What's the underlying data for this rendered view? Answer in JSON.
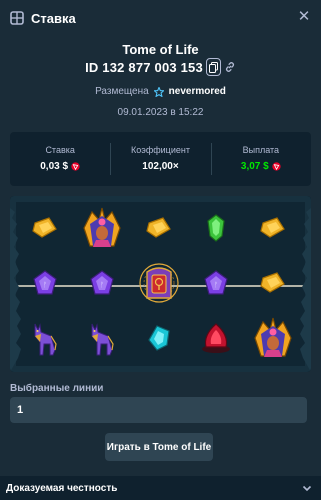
{
  "header": {
    "title": "Ставка"
  },
  "bet": {
    "game_name": "Tome of Life",
    "id": "ID 132 877 003 153",
    "placed_label": "Размещена",
    "user": "nevermored",
    "date": "09.01.2023 в 15:22"
  },
  "stats": {
    "bet_label": "Ставка",
    "bet_value": "0,03 $",
    "multiplier_label": "Коэффициент",
    "multiplier_value": "102,00×",
    "payout_label": "Выплата",
    "payout_value": "3,07 $"
  },
  "board": {
    "rows": [
      [
        "gold-gem-icon",
        "pharaoh-icon",
        "gold-gem-icon",
        "green-gem-icon",
        "gold-gem-icon"
      ],
      [
        "purple-gem-icon",
        "purple-gem-icon",
        "tome-of-life-icon",
        "purple-gem-icon",
        "gold-gem-icon"
      ],
      [
        "anubis-jackal-icon",
        "anubis-jackal-icon",
        "cyan-gem-icon",
        "red-gem-icon",
        "pharaoh-icon"
      ]
    ]
  },
  "lines": {
    "label": "Выбранные линии",
    "value": "1"
  },
  "play_button": "Играть в Tome of Life",
  "footer": {
    "label": "Доказуемая честность"
  },
  "colors": {
    "background": "#1a2c38",
    "panel": "#0f212e",
    "accent_green": "#00e701",
    "muted": "#b1bad3"
  }
}
